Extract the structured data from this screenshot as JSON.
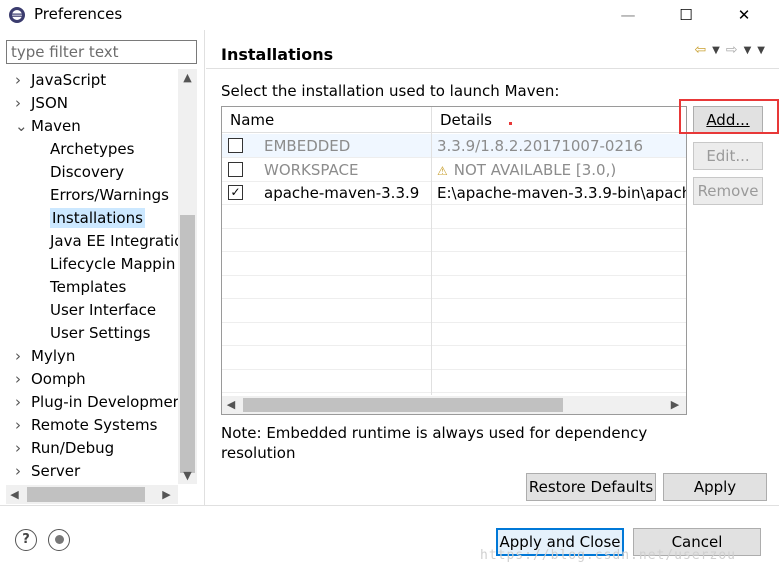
{
  "window": {
    "title": "Preferences",
    "minimize": "—",
    "maximize": "☐",
    "close": "✕"
  },
  "filter": {
    "placeholder": "type filter text"
  },
  "tree": {
    "items": [
      {
        "label": "JavaScript",
        "level": 0,
        "expanded": false
      },
      {
        "label": "JSON",
        "level": 0,
        "expanded": false
      },
      {
        "label": "Maven",
        "level": 0,
        "expanded": true
      },
      {
        "label": "Archetypes",
        "level": 1
      },
      {
        "label": "Discovery",
        "level": 1
      },
      {
        "label": "Errors/Warnings",
        "level": 1
      },
      {
        "label": "Installations",
        "level": 1,
        "selected": true
      },
      {
        "label": "Java EE Integratio",
        "level": 1
      },
      {
        "label": "Lifecycle Mappin",
        "level": 1
      },
      {
        "label": "Templates",
        "level": 1
      },
      {
        "label": "User Interface",
        "level": 1
      },
      {
        "label": "User Settings",
        "level": 1
      },
      {
        "label": "Mylyn",
        "level": 0,
        "expanded": false
      },
      {
        "label": "Oomph",
        "level": 0,
        "expanded": false
      },
      {
        "label": "Plug-in Developmer",
        "level": 0,
        "expanded": false
      },
      {
        "label": "Remote Systems",
        "level": 0,
        "expanded": false
      },
      {
        "label": "Run/Debug",
        "level": 0,
        "expanded": false
      },
      {
        "label": "Server",
        "level": 0,
        "expanded": false
      }
    ]
  },
  "panel": {
    "title": "Installations",
    "instruction": "Select the installation used to launch Maven:",
    "columns": [
      "Name",
      "Details"
    ],
    "rows": [
      {
        "checked": false,
        "name": "EMBEDDED",
        "details": "3.3.9/1.8.2.20171007-0216",
        "disabled": true,
        "warning": false
      },
      {
        "checked": false,
        "name": "WORKSPACE",
        "details": "NOT AVAILABLE [3.0,)",
        "disabled": true,
        "warning": true
      },
      {
        "checked": true,
        "name": "apache-maven-3.3.9",
        "details": "E:\\apache-maven-3.3.9-bin\\apache",
        "disabled": false,
        "warning": false
      }
    ],
    "buttons": {
      "add": "Add...",
      "edit": "Edit...",
      "remove": "Remove"
    },
    "note": "Note: Embedded runtime is always used for dependency resolution",
    "restore_defaults": "Restore Defaults",
    "apply": "Apply"
  },
  "footer": {
    "apply_and_close": "Apply and Close",
    "cancel": "Cancel",
    "help_icon": "?",
    "watermark": "https://blog.csdn.net/userzou"
  },
  "colors": {
    "selection": "#cce8ff",
    "highlight": "#e83838",
    "primary_border": "#0078d7"
  }
}
